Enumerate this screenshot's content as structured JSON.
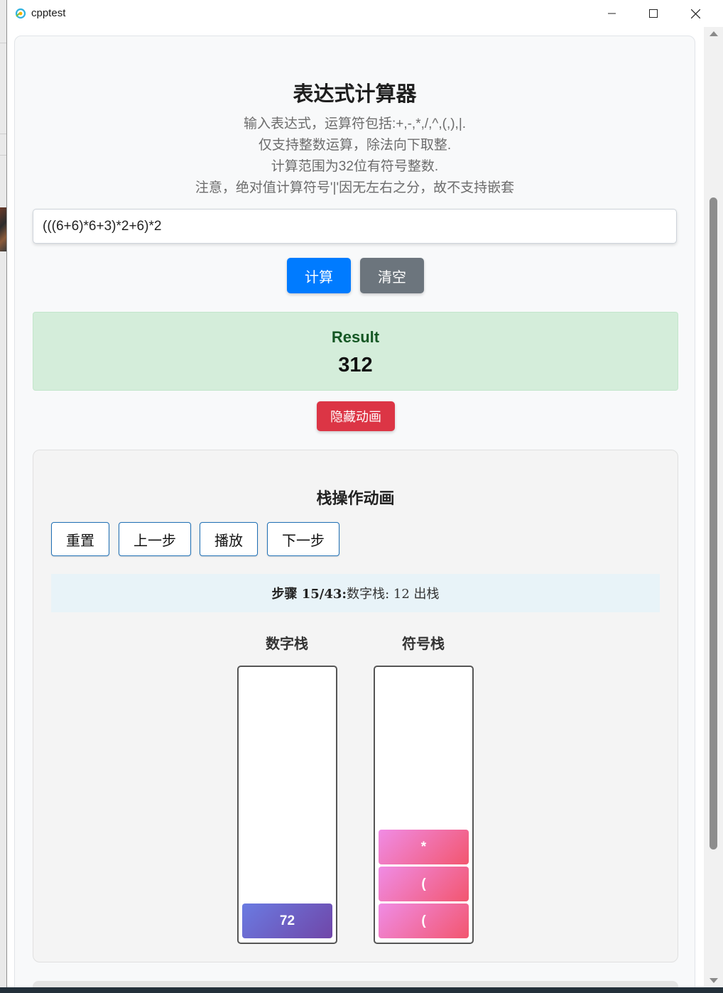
{
  "window": {
    "title": "cpptest"
  },
  "calculator": {
    "heading": "表达式计算器",
    "description": [
      "输入表达式，运算符包括:+,-,*,/,^,(,),|.",
      "仅支持整数运算，除法向下取整.",
      "计算范围为32位有符号整数.",
      "注意，绝对值计算符号'|'因无左右之分，故不支持嵌套"
    ],
    "input_value": "(((6+6)*6+3)*2+6)*2",
    "calc_label": "计算",
    "clear_label": "清空",
    "result_label": "Result",
    "result_value": "312",
    "hide_animation_label": "隐藏动画"
  },
  "animation": {
    "title": "栈操作动画",
    "controls": [
      "重置",
      "上一步",
      "播放",
      "下一步"
    ],
    "step_prefix": "步骤 15/43:",
    "step_text": "数字栈: 12 出栈",
    "number_stack": {
      "title": "数字栈",
      "items": [
        "72"
      ]
    },
    "operator_stack": {
      "title": "符号栈",
      "items": [
        "*",
        "(",
        "("
      ]
    }
  },
  "colors": {
    "primary": "#007bff",
    "secondary": "#6c757d",
    "danger": "#dc3545",
    "success_bg": "#d4edda",
    "success_text": "#155724"
  }
}
